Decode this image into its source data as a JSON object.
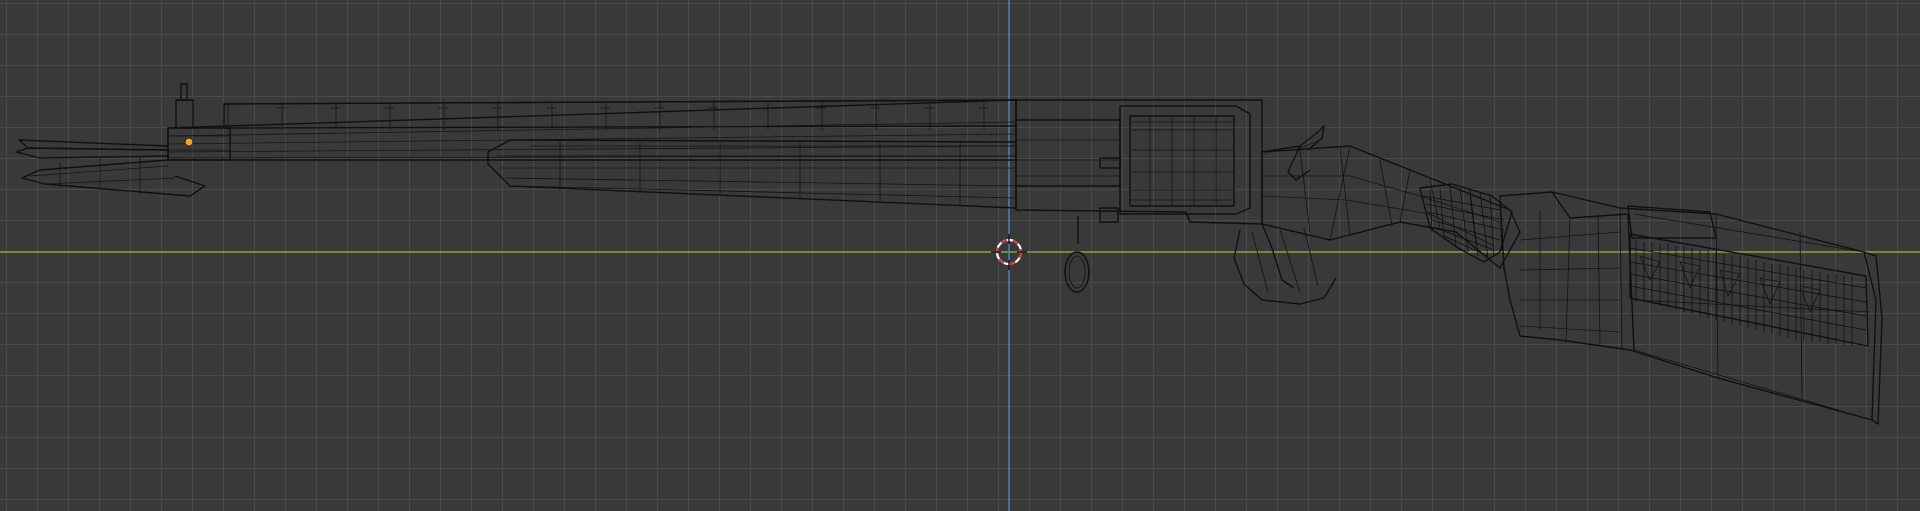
{
  "viewport": {
    "editor": "3D View",
    "shading": "wireframe",
    "grid_color": "#4a4a4a",
    "background_color": "#393939",
    "axis_x_color": "#7ea33c",
    "axis_z_color": "#4f7fc4",
    "wire_color": "#101010",
    "origin_color": "#f5a21e"
  },
  "cursor": {
    "name": "3d-cursor",
    "colors": [
      "#d23a3a",
      "#ffffff"
    ]
  },
  "object": {
    "name": "rifle-mesh",
    "parts": [
      "bayonet",
      "barrel",
      "handguard",
      "revolver-cylinder",
      "frame",
      "hammer",
      "trigger-guard",
      "sling-ring",
      "grip-wrap",
      "stock"
    ]
  }
}
